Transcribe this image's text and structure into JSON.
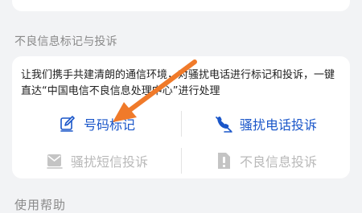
{
  "section": {
    "title": "不良信息标记与投诉",
    "description": "让我们携手共建清朗的通信环境，对骚扰电话进行标记和投诉，一键直达“中国电信不良信息处理中心”进行处理"
  },
  "actions": [
    {
      "label": "号码标记",
      "icon": "edit-icon",
      "enabled": true
    },
    {
      "label": "骚扰电话投诉",
      "icon": "phone-crossed-icon",
      "enabled": true
    },
    {
      "label": "骚扰短信投诉",
      "icon": "message-icon",
      "enabled": false
    },
    {
      "label": "不良信息投诉",
      "icon": "report-icon",
      "enabled": false
    }
  ],
  "next_section": {
    "title": "使用帮助"
  },
  "colors": {
    "accent": "#1a56c9",
    "disabled": "#b9b9b9",
    "arrow": "#f07a2a"
  }
}
